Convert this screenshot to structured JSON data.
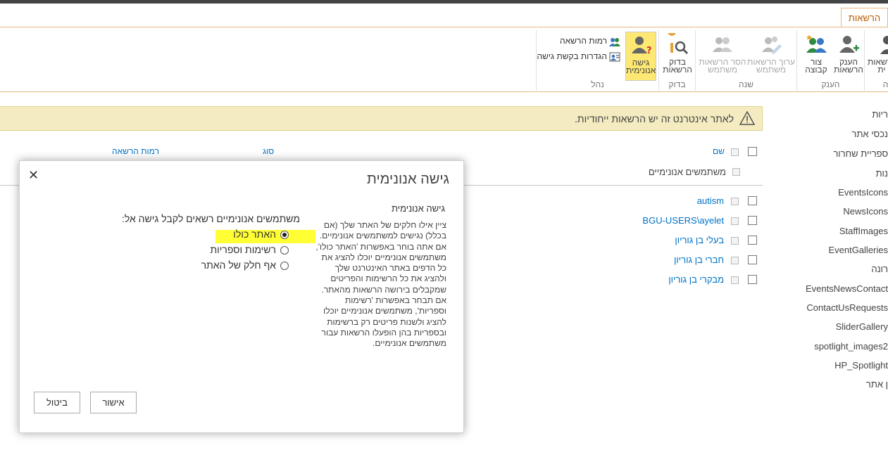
{
  "ribbon": {
    "tab_label": "הרשאות",
    "groups": {
      "grant": {
        "label": "הענק"
      },
      "modify": {
        "label": "שנה"
      },
      "check": {
        "label": "בדוק"
      },
      "manage": {
        "label": "נהל"
      },
      "edge": {
        "label": "ה"
      }
    },
    "buttons": {
      "edge_1": "הרשאות",
      "edge_2": "ית",
      "grant_permissions_1": "הענק",
      "grant_permissions_2": "הרשאות",
      "create_group_1": "צור",
      "create_group_2": "קבוצה",
      "edit_user_1": "ערוך הרשאות",
      "edit_user_2": "משתמש",
      "remove_user_1": "הסר הרשאות",
      "remove_user_2": "משתמש",
      "check_1": "בדוק",
      "check_2": "הרשאות",
      "anon_1": "גישה",
      "anon_2": "אנונימית"
    },
    "small_buttons": {
      "permission_levels": "רמות הרשאה",
      "access_request_settings": "הגדרות בקשת גישה"
    }
  },
  "warning": {
    "text": "לאתר אינטרנט זה יש הרשאות ייחודיות."
  },
  "leftnav": {
    "items": [
      "ריות",
      "נכסי אתר",
      "ספריית שחרור",
      "נות",
      "EventsIcons",
      "NewsIcons",
      "StaffImages",
      "EventGalleries",
      "רונה",
      "EventsNewsContact",
      "ContactUsRequests",
      "SliderGallery",
      "spotlight_images2",
      "HP_Spotlight",
      "ן אתר"
    ]
  },
  "list": {
    "headers": {
      "name": "שם",
      "type": "סוג",
      "levels": "רמות הרשאה"
    },
    "anonymous_row": "משתמשים אנונימיים",
    "rows": [
      "autism",
      "BGU-USERS\\ayelet",
      "בעלי בן גוריון",
      "חברי בן גוריון",
      "מבקרי בן גוריון"
    ]
  },
  "dialog": {
    "title": "גישה אנונימית",
    "close": "✕",
    "section_title": "גישה אנונימית",
    "section_description": "ציין אילו חלקים של האתר שלך (אם בכלל) נגישים למשתמשים אנונימיים. אם אתה בוחר באפשרות 'האתר כולו', משתמשים אנונימיים יוכלו להציג את כל הדפים באתר האינטרנט שלך ולהציג את כל הרשימות והפריטים שמקבלים בירושה הרשאות מהאתר. אם תבחר באפשרות 'רשימות וספריות', משתמשים אנונימיים יוכלו להציג ולשנות פריטים רק ברשימות ובספריות בהן הופעלו הרשאות עבור משתמשים אנונימיים.",
    "options_title": "משתמשים אנונימיים רשאים לקבל גישה אל:",
    "options": {
      "entire_site": "האתר כולו",
      "lists_libraries": "רשימות וספריות",
      "nothing": "אף חלק של האתר"
    },
    "selected": "entire_site",
    "ok": "אישור",
    "cancel": "ביטול"
  },
  "colors": {
    "accent": "#b65c00",
    "link": "#0072c6",
    "warning_bg": "#f4ebc0",
    "highlight": "#ffff33"
  }
}
